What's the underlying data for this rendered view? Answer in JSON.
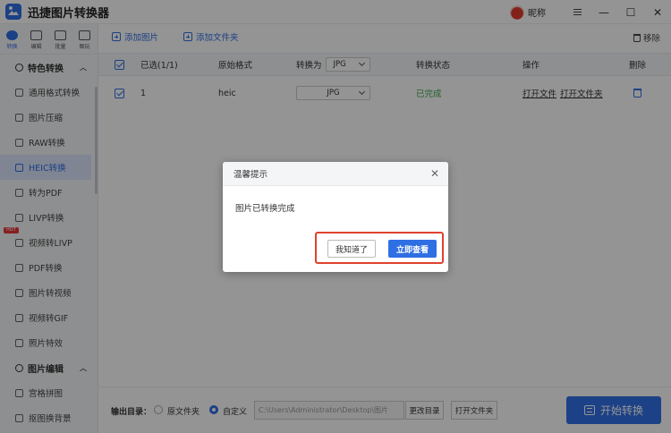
{
  "app": {
    "title": "迅捷图片转换器",
    "nickname": "昵称"
  },
  "top_tabs": [
    {
      "label": "转换"
    },
    {
      "label": "编辑"
    },
    {
      "label": "批量"
    },
    {
      "label": "图玩"
    }
  ],
  "sidebar": {
    "section_convert": "特色转换",
    "items": [
      {
        "label": "通用格式转换"
      },
      {
        "label": "图片压缩"
      },
      {
        "label": "RAW转换"
      },
      {
        "label": "HEIC转换"
      },
      {
        "label": "转为PDF"
      },
      {
        "label": "LIVP转换"
      },
      {
        "label": "视频转LIVP",
        "badge": "HOT"
      },
      {
        "label": "PDF转换"
      },
      {
        "label": "图片转视频"
      },
      {
        "label": "视频转GIF"
      },
      {
        "label": "照片特效"
      }
    ],
    "section_edit": "图片编辑",
    "edit_items": [
      {
        "label": "宫格拼图"
      },
      {
        "label": "抠图换背景"
      }
    ]
  },
  "toolbar": {
    "add_image": "添加图片",
    "add_folder": "添加文件夹",
    "remove": "移除"
  },
  "table": {
    "headers": {
      "selected": "已选(1/1)",
      "orig_format": "原始格式",
      "convert_to": "转换为",
      "convert_to_value": "JPG",
      "status": "转换状态",
      "action": "操作",
      "delete": "删除"
    },
    "rows": [
      {
        "index": "1",
        "format": "heic",
        "target": "JPG",
        "status": "已完成",
        "open_file": "打开文件",
        "open_folder": "打开文件夹"
      }
    ]
  },
  "bottom": {
    "output_label": "输出目录：",
    "opt_source": "原文件夹",
    "opt_custom": "自定义",
    "path": "C:\\Users\\Administrator\\Desktop\\图片",
    "change_dir": "更改目录",
    "open_folder": "打开文件夹",
    "start": "开始转换"
  },
  "dialog": {
    "title": "温馨提示",
    "message": "图片已转换完成",
    "btn_ok": "我知道了",
    "btn_view": "立即查看"
  },
  "colors": {
    "accent": "#2f6fe4",
    "success": "#3aa54a",
    "highlight": "#e0422e"
  }
}
